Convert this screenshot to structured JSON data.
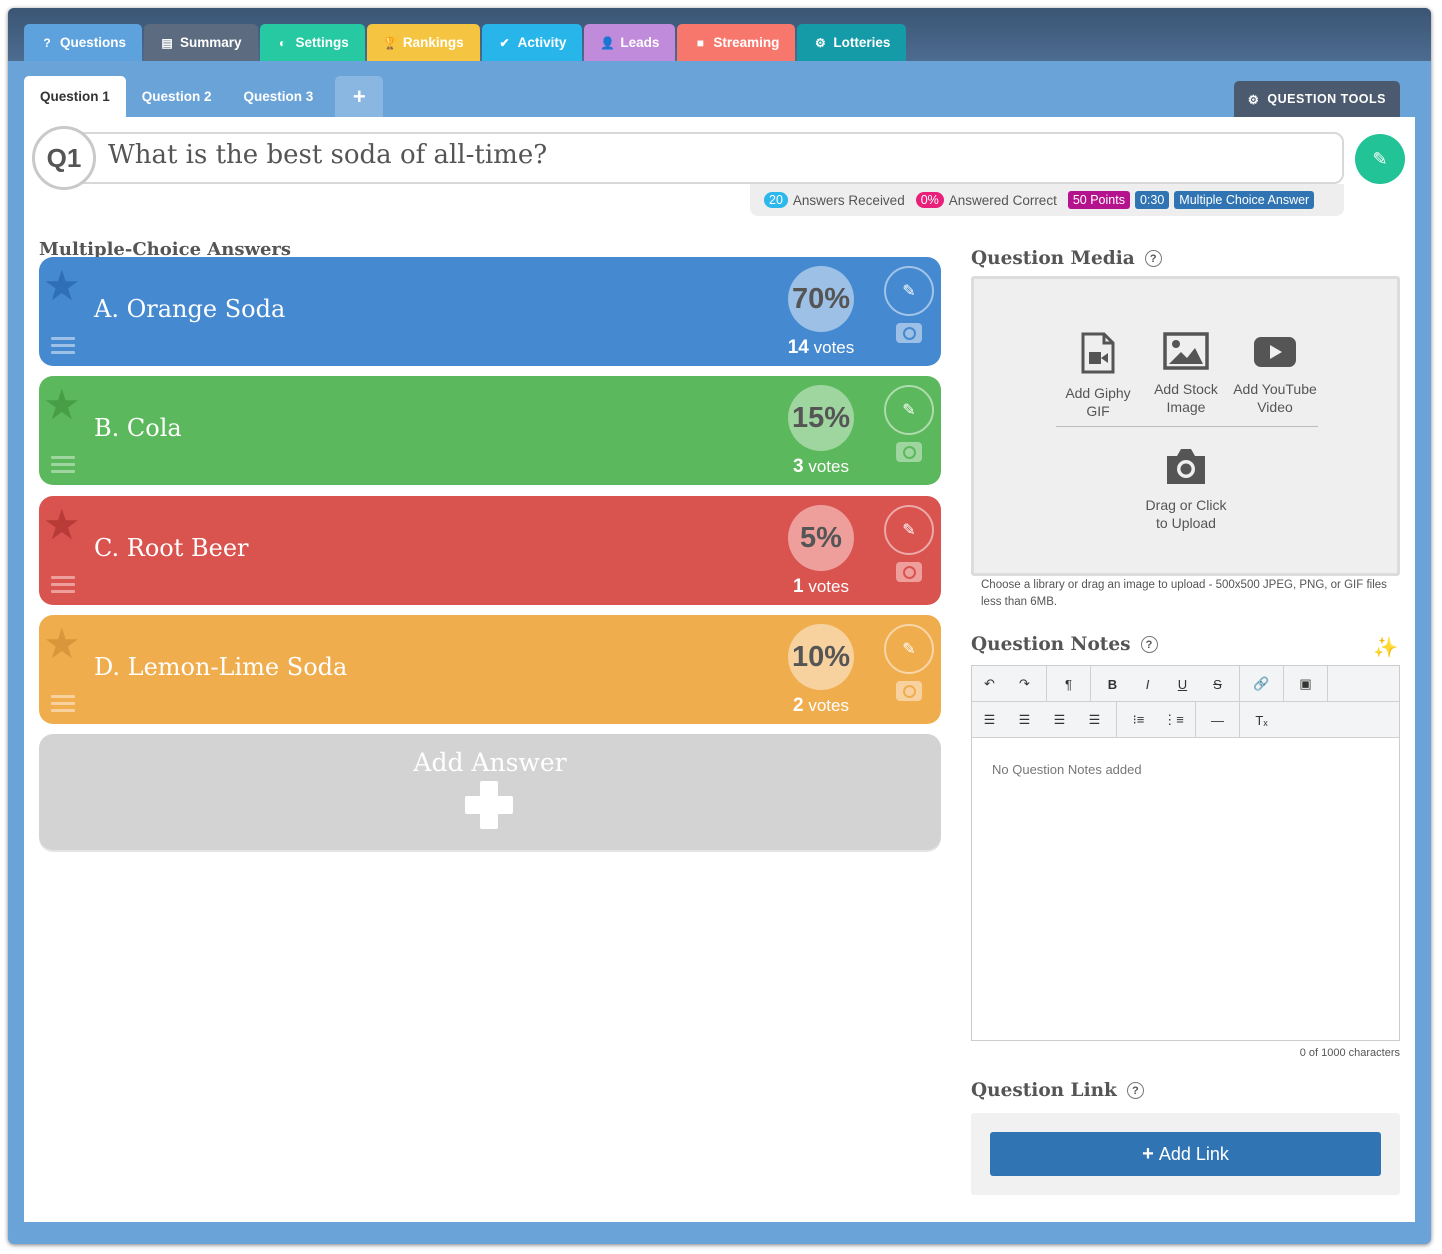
{
  "main_tabs": [
    {
      "label": "Questions",
      "icon": "question-icon",
      "color": "#5ea2dd"
    },
    {
      "label": "Summary",
      "icon": "list-icon",
      "color": "#5c6b80"
    },
    {
      "label": "Settings",
      "icon": "toggle-icon",
      "color": "#27c9a3"
    },
    {
      "label": "Rankings",
      "icon": "trophy-icon",
      "color": "#f5c542"
    },
    {
      "label": "Activity",
      "icon": "check-circle-icon",
      "color": "#28b6ea"
    },
    {
      "label": "Leads",
      "icon": "user-icon",
      "color": "#c18bdc"
    },
    {
      "label": "Streaming",
      "icon": "video-icon",
      "color": "#f7776d"
    },
    {
      "label": "Lotteries",
      "icon": "gear-icon",
      "color": "#159aa8"
    }
  ],
  "sub_tabs": [
    "Question 1",
    "Question 2",
    "Question 3"
  ],
  "add_question_symbol": "+",
  "question_tools_label": "QUESTION TOOLS",
  "question": {
    "badge": "Q1",
    "text": "What is the best soda of all-time?"
  },
  "stats": {
    "answers_received_count": "20",
    "answers_received_label": "Answers Received",
    "answered_correct_pct": "0%",
    "answered_correct_label": "Answered Correct",
    "points": "50 Points",
    "time": "0:30",
    "type": "Multiple Choice Answer"
  },
  "answers_heading": "Multiple-Choice Answers",
  "answers": [
    {
      "label": "A. Orange Soda",
      "percent": "70%",
      "votes": "14",
      "votes_word": "votes",
      "color": "#4589d0",
      "dark": "#2f6fb8",
      "light": "#9dc0e6"
    },
    {
      "label": "B. Cola",
      "percent": "15%",
      "votes": "3",
      "votes_word": "votes",
      "color": "#5cb85c",
      "dark": "#479e47",
      "light": "#9fd59f"
    },
    {
      "label": "C. Root Beer",
      "percent": "5%",
      "votes": "1",
      "votes_word": "votes",
      "color": "#d9534f",
      "dark": "#b83b37",
      "light": "#ee9f9c"
    },
    {
      "label": "D. Lemon-Lime Soda",
      "percent": "10%",
      "votes": "2",
      "votes_word": "votes",
      "color": "#f0ad4e",
      "dark": "#d9963a",
      "light": "#f7d29f"
    }
  ],
  "add_answer_label": "Add Answer",
  "media": {
    "title": "Question Media",
    "help": "?",
    "items": [
      {
        "label": "Add Giphy GIF",
        "icon": "gif-file-icon"
      },
      {
        "label": "Add Stock Image",
        "icon": "image-icon"
      },
      {
        "label": "Add YouTube Video",
        "icon": "youtube-icon"
      }
    ],
    "upload_label": "Drag or Click to Upload",
    "note": "Choose a library or drag an image to upload - 500x500 JPEG, PNG, or GIF files less than 6MB."
  },
  "notes": {
    "title": "Question Notes",
    "help": "?",
    "placeholder": "No Question Notes added",
    "char_count": "0 of 1000 characters"
  },
  "link": {
    "title": "Question Link",
    "help": "?",
    "button_label": "Add Link"
  }
}
